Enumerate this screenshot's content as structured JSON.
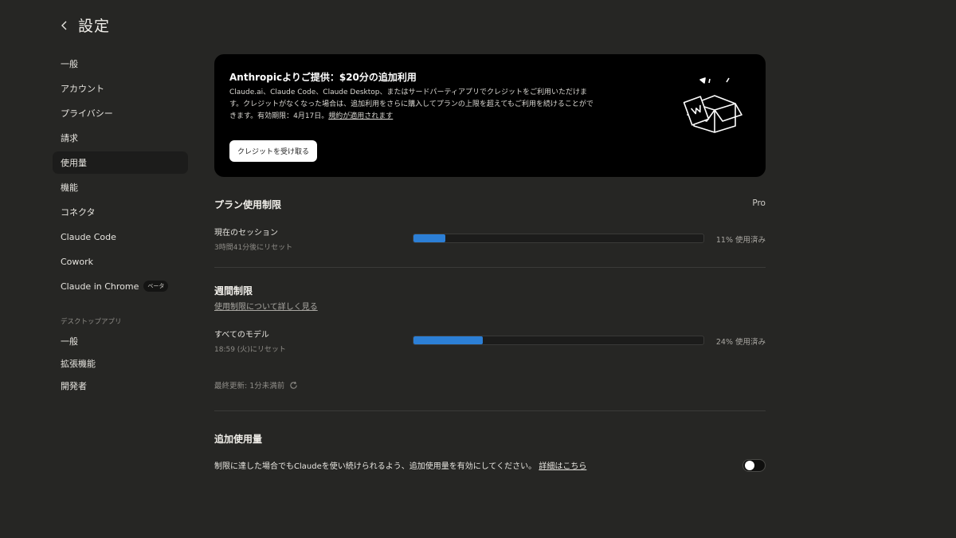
{
  "header": {
    "title": "設定"
  },
  "sidebar": {
    "items": [
      {
        "label": "一般"
      },
      {
        "label": "アカウント"
      },
      {
        "label": "プライバシー"
      },
      {
        "label": "請求"
      },
      {
        "label": "使用量",
        "active": true
      },
      {
        "label": "機能"
      },
      {
        "label": "コネクタ"
      },
      {
        "label": "Claude Code"
      },
      {
        "label": "Cowork"
      },
      {
        "label": "Claude in Chrome",
        "badge": "ベータ"
      }
    ],
    "desktop_section_label": "デスクトップアプリ",
    "desktop_items": [
      {
        "label": "一般"
      },
      {
        "label": "拡張機能"
      },
      {
        "label": "開発者"
      }
    ]
  },
  "promo": {
    "title": "Anthropicよりご提供：$20分の追加利用",
    "body": "Claude.ai、Claude Code、Claude Desktop、またはサードパーティアプリでクレジットをご利用いただけます。クレジットがなくなった場合は、追加利用をさらに購入してプランの上限を超えてもご利用を続けることができます。有効期限：4月17日。",
    "terms_link": "規約が適用されます",
    "button_label": "クレジットを受け取る"
  },
  "plan_limits": {
    "title": "プラン使用制限",
    "plan": "Pro",
    "session": {
      "label": "現在のセッション",
      "reset": "3時間41分後にリセット",
      "percent": 11,
      "percent_label": "11% 使用済み"
    }
  },
  "weekly": {
    "title": "週間制限",
    "learn_more": "使用制限について詳しく見る",
    "all_models": {
      "label": "すべてのモデル",
      "reset": "18:59 (火)にリセット",
      "percent": 24,
      "percent_label": "24% 使用済み"
    },
    "last_updated": "最終更新: 1分未満前"
  },
  "extra_usage": {
    "title": "追加使用量",
    "description": "制限に達した場合でもClaudeを使い続けられるよう、追加使用量を有効にしてください。",
    "details_link": "詳細はこちら",
    "enabled": false
  },
  "colors": {
    "background": "#262624",
    "promo_background": "#000000",
    "progress_fill": "#2c7fd6"
  }
}
